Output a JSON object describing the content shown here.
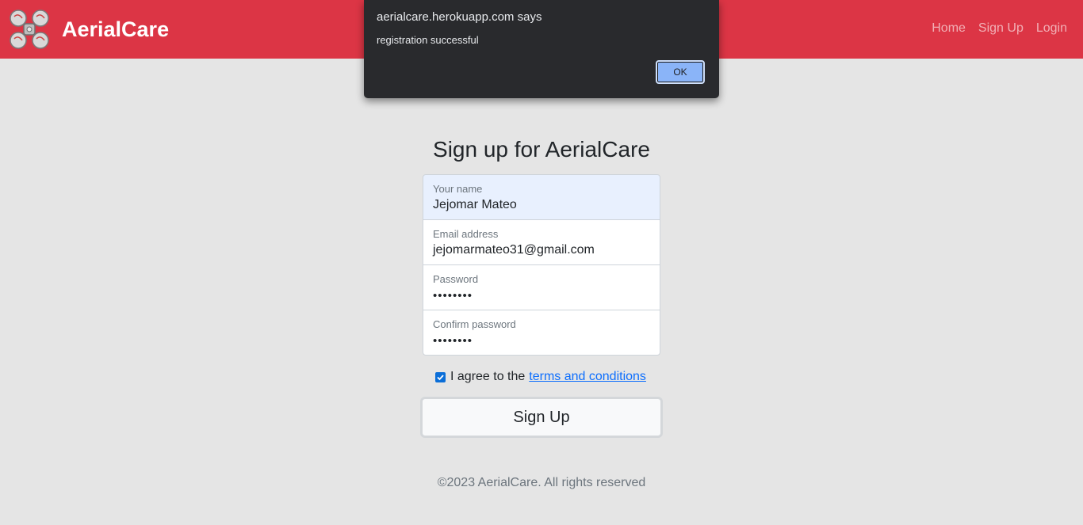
{
  "navbar": {
    "brand": "AerialCare",
    "links": [
      "Home",
      "Sign Up",
      "Login"
    ]
  },
  "form": {
    "title": "Sign up for AerialCare",
    "fields": [
      {
        "label": "Your name",
        "value": "Jejomar Mateo"
      },
      {
        "label": "Email address",
        "value": "jejomarmateo31@gmail.com"
      },
      {
        "label": "Password",
        "value": "••••••••"
      },
      {
        "label": "Confirm password",
        "value": "••••••••"
      }
    ],
    "agree_text": "I agree to the",
    "agree_link": "terms and conditions",
    "agree_checked": true,
    "submit_label": "Sign Up"
  },
  "footer": {
    "text": "©2023 AerialCare. All rights reserved"
  },
  "dialog": {
    "title": "aerialcare.herokuapp.com says",
    "message": "registration successful",
    "ok_label": "OK"
  },
  "colors": {
    "navbar": "#dc3545",
    "page_background": "#e5e5e5",
    "link": "#0d6efd",
    "dialog_background": "#292a2d",
    "dialog_button": "#8ab4f8"
  }
}
